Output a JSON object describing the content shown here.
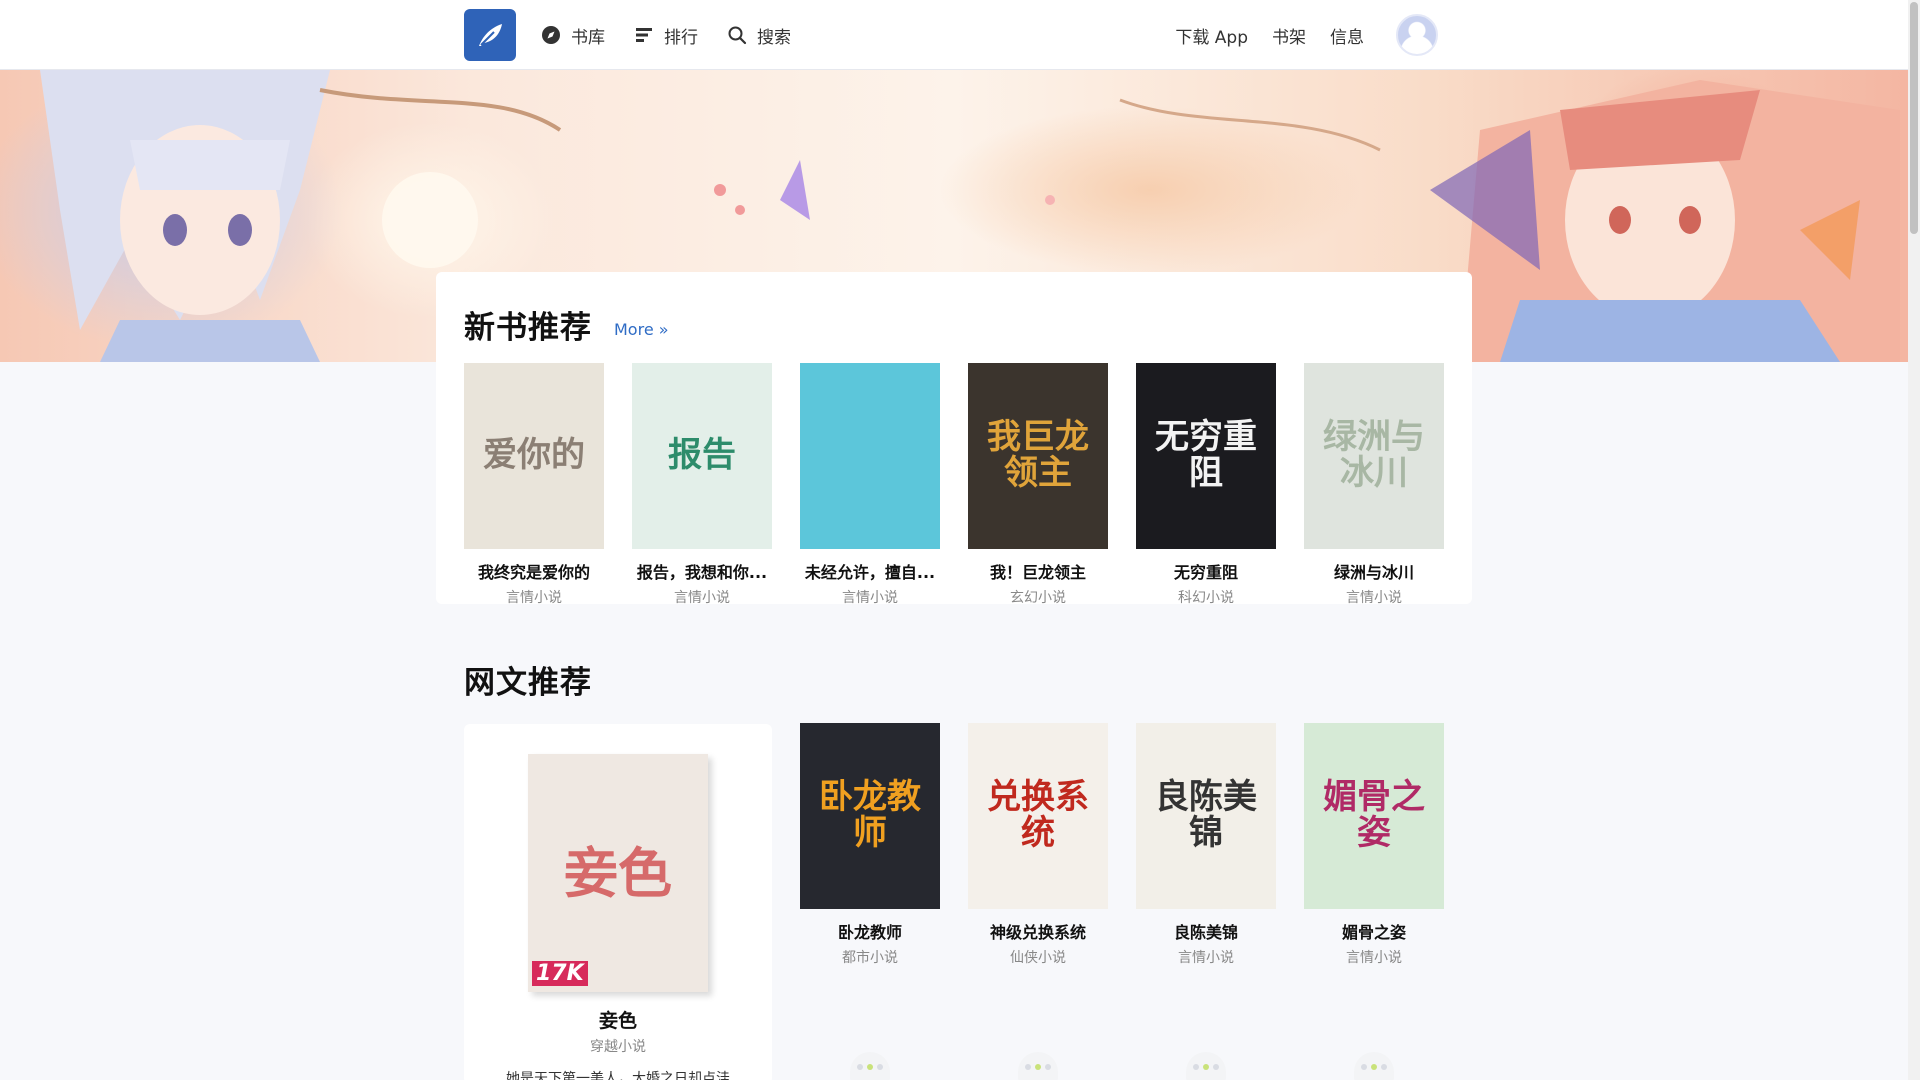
{
  "nav": {
    "logo_icon": "feather-icon",
    "left": [
      {
        "label": "书库",
        "icon": "compass-icon"
      },
      {
        "label": "排行",
        "icon": "ranking-icon"
      },
      {
        "label": "搜索",
        "icon": "search-icon"
      }
    ],
    "right": [
      {
        "label": "下载 App"
      },
      {
        "label": "书架"
      },
      {
        "label": "信息"
      }
    ],
    "avatar_icon": "user-avatar-icon"
  },
  "new_books": {
    "title": "新书推荐",
    "more_label": "More »",
    "books": [
      {
        "title": "我终究是爱你的",
        "genre": "言情小说",
        "cover_text": "爱你的",
        "bg": "#e9e4da",
        "fg": "#8b7f74"
      },
      {
        "title": "报告，我想和你...",
        "genre": "言情小说",
        "cover_text": "报告",
        "bg": "#e3efe9",
        "fg": "#2d8c6b"
      },
      {
        "title": "未经允许，擅自...",
        "genre": "言情小说",
        "cover_text": "",
        "bg": "#5cc6da",
        "fg": "#ffffff"
      },
      {
        "title": "我！巨龙领主",
        "genre": "玄幻小说",
        "cover_text": "我巨龙领主",
        "bg": "#3b342d",
        "fg": "#e0a43a"
      },
      {
        "title": "无穷重阻",
        "genre": "科幻小说",
        "cover_text": "无穷重阻",
        "bg": "#1b1b1f",
        "fg": "#f3f3f3"
      },
      {
        "title": "绿洲与冰川",
        "genre": "言情小说",
        "cover_text": "绿洲与冰川",
        "bg": "#dfe4de",
        "fg": "#a8b7a4"
      }
    ]
  },
  "web_books": {
    "title": "网文推荐",
    "featured": {
      "title": "妾色",
      "genre": "穿越小说",
      "desc": "她是天下第一美人，大婚之日却点洼",
      "cover_text": "妾色",
      "badge": "17K",
      "bg": "#efe8e2",
      "fg": "#d66a6a"
    },
    "books": [
      {
        "title": "卧龙教师",
        "genre": "都市小说",
        "cover_text": "卧龙教师",
        "bg": "#26282f",
        "fg": "#f0a020"
      },
      {
        "title": "神级兑换系统",
        "genre": "仙侠小说",
        "cover_text": "兑换系统",
        "bg": "#f4f0ea",
        "fg": "#c0291e"
      },
      {
        "title": "良陈美锦",
        "genre": "言情小说",
        "cover_text": "良陈美锦",
        "bg": "#f2efe8",
        "fg": "#333333"
      },
      {
        "title": "媚骨之姿",
        "genre": "言情小说",
        "cover_text": "媚骨之姿",
        "bg": "#d6ead6",
        "fg": "#b02a66"
      }
    ]
  }
}
